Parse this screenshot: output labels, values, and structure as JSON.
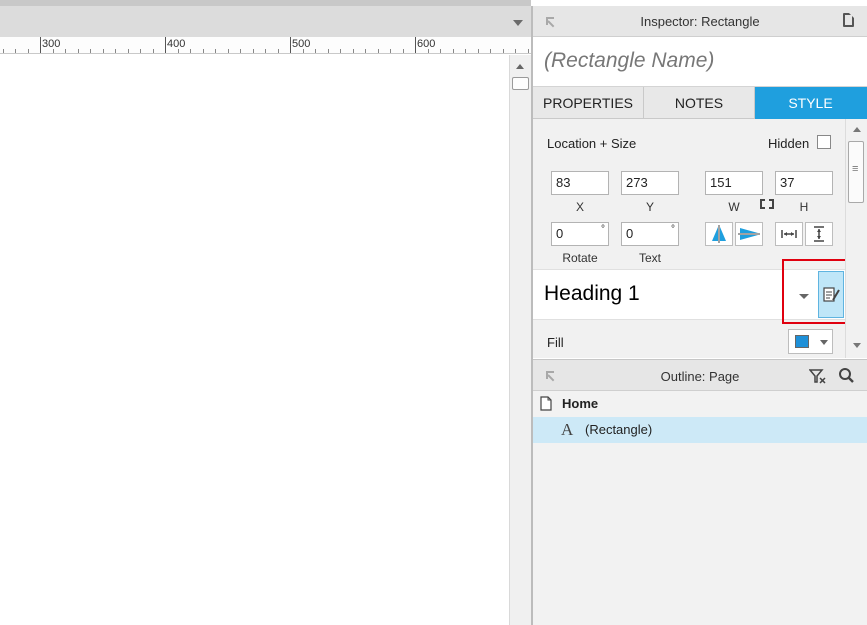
{
  "ruler": {
    "labels": [
      "300",
      "400",
      "500",
      "600"
    ]
  },
  "inspector": {
    "title": "Inspector: Rectangle",
    "widget_name": "(Rectangle Name)",
    "tabs": [
      {
        "label": "PROPERTIES",
        "active": false
      },
      {
        "label": "NOTES",
        "active": false
      },
      {
        "label": "STYLE",
        "active": true
      }
    ],
    "location_size": {
      "section_label": "Location + Size",
      "hidden_label": "Hidden",
      "hidden_checked": false,
      "x": "83",
      "y": "273",
      "w": "151",
      "h": "37",
      "x_label": "X",
      "y_label": "Y",
      "w_label": "W",
      "h_label": "H",
      "rotate": "0",
      "text_rotate": "0",
      "rotate_label": "Rotate",
      "text_label": "Text",
      "degree_symbol": "°"
    },
    "widget_style": {
      "name": "Heading 1"
    },
    "fill": {
      "label": "Fill",
      "color": "#1e90d8"
    },
    "accent_color": "#1f9fde"
  },
  "outline": {
    "title": "Outline: Page",
    "page": {
      "label": "Home"
    },
    "items": [
      {
        "label": "(Rectangle)",
        "icon": "text-a-icon",
        "selected": true
      }
    ]
  }
}
